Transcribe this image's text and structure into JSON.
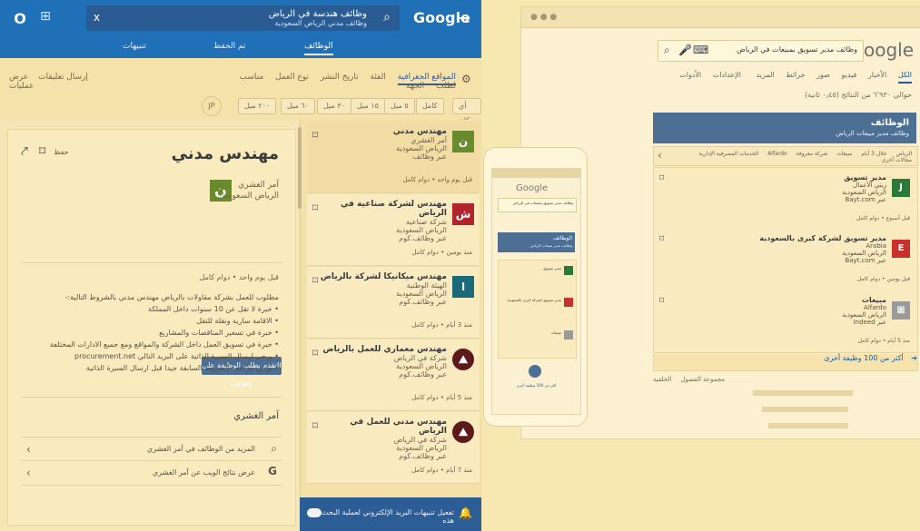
{
  "left": {
    "topbar": {
      "app_icon": "circle-icon",
      "grid_icon": "grid-icon",
      "close_label": "x",
      "search_text": "وظائف هندسة في الرياض",
      "search_subtext": "وظائف مدني الرياض السعودية",
      "google_label": "Google",
      "forward_icon": "arrow-right-icon"
    },
    "tabs": [
      {
        "label": "الوظائف",
        "active": true
      },
      {
        "label": "تم الحفظ",
        "active": false
      },
      {
        "label": "تنبيهات",
        "active": false
      }
    ],
    "filters": {
      "row1": [
        "المواقع الجغرافية",
        "الفئة",
        "تاريخ النشر",
        "نوع العمل",
        "مناسب لطلب",
        "الجهة"
      ],
      "links": [
        "إرسال تعليقات",
        "عرض عمليات"
      ],
      "pills": [
        "أي مكان",
        "كامل",
        "٥ ميل",
        "١٥ ميل",
        "٣٠ ميل",
        "٦٠ ميل",
        "٢٠٠ ميل",
        "أي مكان"
      ]
    },
    "detail": {
      "title": "مهندس مدني",
      "company": "آمر الغشري",
      "location": "الرياض السعودية",
      "apply_button": "التقدم بطلب الوظيفة على وظائف",
      "meta_line": "قبل يوم واحد ‏• دوام كامل",
      "description": [
        "مطلوب للعمل بشركة مقاولات بالرياض مهندس مدني بالشروط التالية:-",
        "• خبرة لا تقل عن 10 سنوات داخل المملكة",
        "• الاقامة سارية ونقلة للتقل",
        "• خبرة في تسعير المناقصات والمشاريع",
        "• خبرة في تسويق العمل داخل الشركة والمواقع ومع جميع الادارات المختلفة",
        "• يرجى ارسال السيرة الذاتية على البريد التالي procurement.net",
        "• يرجى مراجعة الشروط السابقة جيدا قبل ارسال السيرة الذاتية"
      ],
      "section_title": "آمر الغشري",
      "related": [
        {
          "icon": "search-icon",
          "text": "المزيد من الوظائف في آمر الغشري"
        },
        {
          "icon": "google-icon",
          "text": "عرض نتائج الويب عن آمر الغشري"
        }
      ]
    },
    "jobs": [
      {
        "title": "مهندس مدني",
        "company": "آمر الغشري",
        "location": "الرياض السعودية",
        "via": "عبر وظائف",
        "meta": "قبل يوم واحد ‏• دوام كامل",
        "logo": "ن",
        "logo_color": "#6a8a2e"
      },
      {
        "title": "مهندس لشركة صناعية في الرياض",
        "company": "شركة صناعية",
        "location": "الرياض السعودية",
        "via": "عبر وظائف.كوم",
        "meta": "منذ يومين ‏• دوام كامل",
        "logo": "ش",
        "logo_color": "#b2242c"
      },
      {
        "title": "مهندس ميكانيكا لشركة بالرياض",
        "company": "الهيئة الوطنية",
        "location": "الرياض السعودية",
        "via": "عبر وظائف.كوم",
        "meta": "منذ 3 أيام ‏• دوام كامل",
        "logo": "ا",
        "logo_color": "#1b6a7a"
      },
      {
        "title": "مهندس معماري للعمل بالرياض",
        "company": "شركة في الرياض",
        "location": "الرياض السعودية",
        "via": "عبر وظائف.كوم",
        "meta": "منذ 5 أيام ‏• دوام كامل",
        "logo": "⛰",
        "logo_color": "#5c1a1a"
      },
      {
        "title": "مهندس مدني للعمل في الرياض",
        "company": "شركة في الرياض",
        "location": "الرياض السعودية",
        "via": "عبر وظائف.كوم",
        "meta": "منذ 7 أيام ‏• دوام كامل",
        "logo": "⛰",
        "logo_color": "#5c1a1a"
      }
    ],
    "bottom_bar": "تفعيل تنبيهات البريد الإلكتروني لعملية البحث هذه"
  },
  "desktop": {
    "search_text": "وظائف مدير تسويق بمبيعات في الرياض",
    "google_label": "Google",
    "tabs": [
      "الكل",
      "الأخبار",
      "فيديو",
      "صور",
      "خرائط",
      "المزيد",
      "الإعدادات",
      "الأدوات"
    ],
    "results_count": "حوالي ٦٬٩٣٠ من النتائج (٠٫٤٥ ثانية)",
    "jobs_card_title": "الوظائف",
    "jobs_card_sub": "وظائف مدير مبيعات الرياض",
    "filters": [
      "الرياض",
      "خلال 3 أيام",
      "مبيعات",
      "شركة معروفة",
      "Alfardo",
      "الخدمات المصرفية الإدارية",
      "مجالات أخرى"
    ],
    "jobs": [
      {
        "title": "مدير تسويق",
        "company": "زيتي الأعمال",
        "location": "الرياض السعودية",
        "via": "عبر Bayt.com",
        "meta": "قبل أسبوع ‏• دوام كامل",
        "logo": "J",
        "logo_color": "#2c7a3a"
      },
      {
        "title": "مدير تسويق لشركة كبرى بالسعودية",
        "company": "Arabia",
        "location": "الرياض السعودية",
        "via": "عبر Bayt.com",
        "meta": "قبل يومين ‏• دوام كامل",
        "logo": "E",
        "logo_color": "#c9312f"
      },
      {
        "title": "مبيعات",
        "company": "Alfardo",
        "location": "الرياض السعودية",
        "via": "عبر Indeed",
        "meta": "منذ 5 أيام ‏• دوام كامل",
        "logo": "▦",
        "logo_color": "#9a9a9a"
      }
    ],
    "more_jobs": "أكثر من 100 وظيفة أخرى",
    "bottom_links": [
      "مجموعة الفضول",
      "الخلفية"
    ]
  },
  "phone": {
    "google_label": "Google",
    "search_text": "وظائف مدير تسويق بمبيعات في الرياض",
    "card_title": "الوظائف",
    "card_sub": "وظائف مدير مبيعات الرياض",
    "items": [
      "مدير تسويق",
      "مدير تسويق لشركة كبرى بالسعودية",
      "مبيعات"
    ],
    "footer": "أكثر من 100 وظيفة أخرى"
  }
}
